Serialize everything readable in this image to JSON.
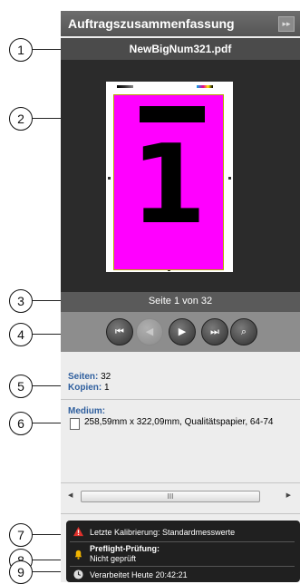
{
  "header": {
    "title": "Auftragszusammenfassung",
    "collapse_icon": "double-arrow-right-icon"
  },
  "file": {
    "name": "NewBigNum321.pdf"
  },
  "preview": {
    "page_number_glyph": "1",
    "page_color": "#ff00ff"
  },
  "page_info": "Seite 1 von 32",
  "nav": {
    "first_icon": "skip-first-icon",
    "first_glyph": "⏮",
    "prev_icon": "prev-icon",
    "prev_glyph": "◀",
    "next_icon": "next-icon",
    "next_glyph": "▶",
    "last_icon": "skip-last-icon",
    "last_glyph": "⏭",
    "zoom_icon": "magnifier-icon",
    "zoom_glyph": "⌕"
  },
  "stats": {
    "pages_label": "Seiten:",
    "pages_value": "32",
    "copies_label": "Kopien:",
    "copies_value": "1"
  },
  "medium": {
    "label": "Medium:",
    "value": "258,59mm x 322,09mm, Qualitätspapier, 64-74"
  },
  "scrollbar": {
    "thumb_grip": "III"
  },
  "status": {
    "calibration": "Letzte Kalibrierung: Standardmesswerte",
    "preflight_title": "Preflight-Prüfung:",
    "preflight_value": "Nicht geprüft",
    "processed": "Verarbeitet Heute 20:42:21"
  },
  "callouts": [
    "1",
    "2",
    "3",
    "4",
    "5",
    "6",
    "7",
    "8",
    "9"
  ]
}
